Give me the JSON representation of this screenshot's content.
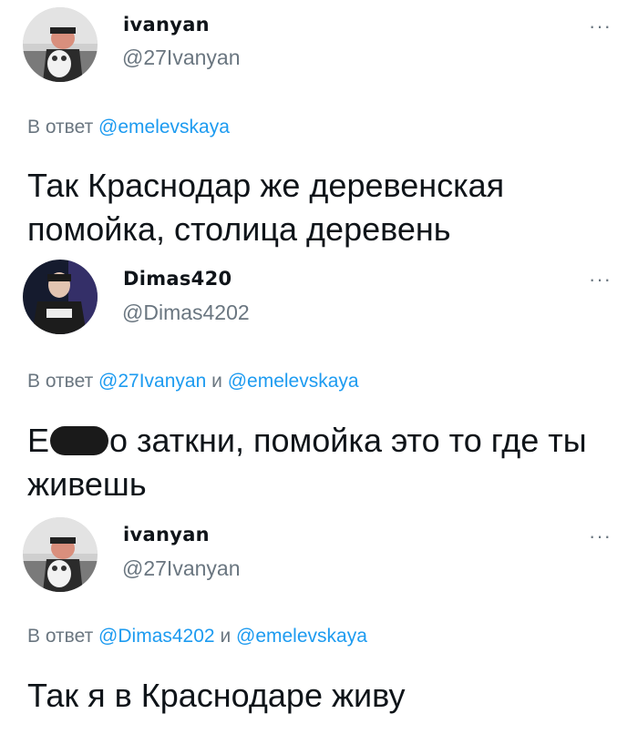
{
  "tweets": [
    {
      "display_name": "ivanyan",
      "handle": "@27Ivanyan",
      "more": "···",
      "reply_prefix": "В ответ",
      "mentions": [
        "@emelevskaya"
      ],
      "conjunction": "",
      "text": "Так Краснодар же деревенская помойка, столица деревень"
    },
    {
      "display_name": "Dimas420",
      "handle": "@Dimas4202",
      "more": "···",
      "reply_prefix": "В ответ",
      "mentions": [
        "@27Ivanyan",
        "@emelevskaya"
      ],
      "conjunction": "и",
      "text_start": "Е",
      "text_rest": "о заткни, помойка это то где ты живешь"
    },
    {
      "display_name": "ivanyan",
      "handle": "@27Ivanyan",
      "more": "···",
      "reply_prefix": "В ответ",
      "mentions": [
        "@Dimas4202",
        "@emelevskaya"
      ],
      "conjunction": "и",
      "text": "Так я в Краснодаре живу"
    }
  ]
}
